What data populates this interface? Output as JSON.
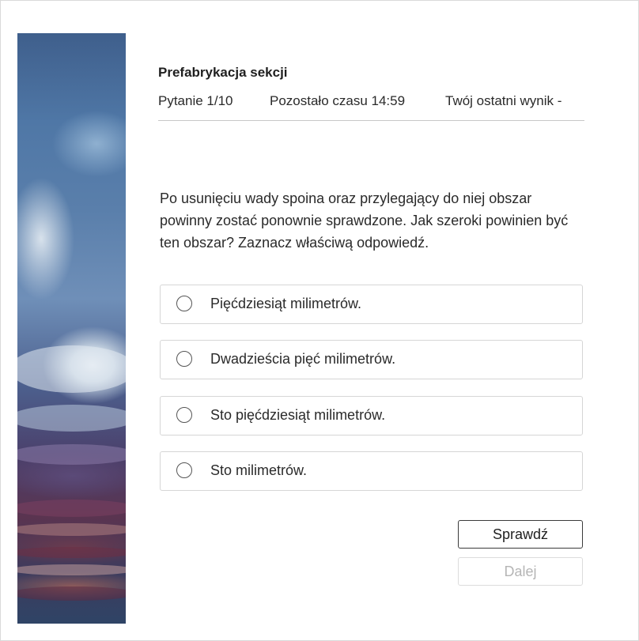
{
  "quiz": {
    "title": "Prefabrykacja sekcji",
    "question_counter": "Pytanie 1/10",
    "time_left": "Pozostało czasu 14:59",
    "last_score": "Twój ostatni wynik -"
  },
  "question": {
    "text": "Po usunięciu wady spoina oraz przylegający do niej obszar powinny zostać ponownie sprawdzone. Jak szeroki powinien być ten obszar? Zaznacz właściwą odpowiedź.",
    "options": [
      {
        "label": "Pięćdziesiąt milimetrów.",
        "selected": false
      },
      {
        "label": "Dwadzieścia pięć milimetrów.",
        "selected": false
      },
      {
        "label": "Sto pięćdziesiąt milimetrów.",
        "selected": false
      },
      {
        "label": "Sto milimetrów.",
        "selected": false
      }
    ]
  },
  "actions": {
    "check_label": "Sprawdź",
    "next_label": "Dalej",
    "next_enabled": false
  },
  "side_image": {
    "icon": "mineral-texture-image"
  }
}
